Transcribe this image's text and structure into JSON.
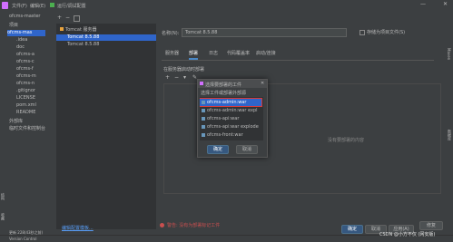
{
  "topbar": {
    "menu_file": "文件(F)",
    "menu_edit": "编辑(E)",
    "window_title": "运行/调试配置"
  },
  "project": {
    "root": "ofcms-master",
    "items": [
      "项目",
      "ofcms-mas",
      ".idea",
      "doc",
      "ofcms-a",
      "ofcms-c",
      "ofcms-f",
      "ofcms-m",
      "ofcms-n",
      ".gitignor",
      "LICENSE",
      "pom.xml",
      "README",
      "外部库",
      "临时文件和控制台"
    ]
  },
  "config_tree": {
    "group": "Tomcat 服务器",
    "items": [
      "Tomcat 8.5.88",
      "Tomcat 8.5.88"
    ],
    "edit_templates_link": "编辑配置模板..."
  },
  "config": {
    "name_label": "名称(N):",
    "name_value": "Tomcat 8.5.88",
    "store_checkbox": "存储为项目文件(S)",
    "tabs": [
      "服务器",
      "部署",
      "日志",
      "代码覆盖率",
      "启动/连接"
    ],
    "deploy_label": "在服务器启动时部署",
    "empty_hint": "没有要部署的内容"
  },
  "modal": {
    "title": "选择要部署的工件",
    "subtitle": "选择工件或部署外部源",
    "artifacts": [
      "ofcms-admin:war",
      "ofcms-admin:war expl",
      "ofcms-api:war",
      "ofcms-api:war explode",
      "ofcms-front:war"
    ],
    "ok": "确定",
    "cancel": "取消"
  },
  "warning": {
    "text": "警告: 没有为部署标记工件",
    "fix_button": "修复"
  },
  "footer_buttons": {
    "ok": "确定",
    "cancel": "取消",
    "apply": "应用(A)"
  },
  "statusbar": {
    "vcs": "Version Control",
    "status": "更新 228(43秒之前)"
  },
  "watermark": "CSDN @小方不仅 (网安版)",
  "left_tools": [
    "结构",
    "收藏",
    "Web"
  ],
  "right_tools": [
    "Maven",
    "数据库"
  ]
}
